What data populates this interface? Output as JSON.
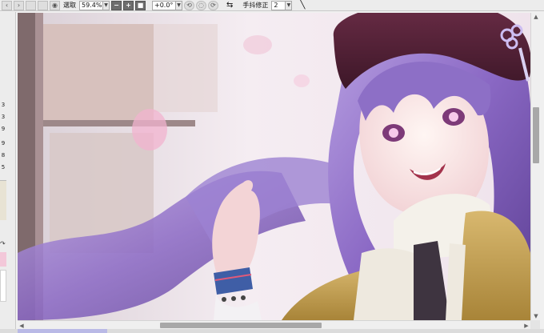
{
  "toolbar": {
    "tool_mode_label": "選取",
    "zoom_value": "59.4%",
    "rotation_value": "+0.0°",
    "stabilizer_label": "手抖修正",
    "stabilizer_value": "2"
  },
  "left_strip": {
    "numbers": [
      "3",
      "3",
      "9",
      "9",
      "8",
      "5"
    ]
  },
  "icons": {
    "eye": "eye-icon",
    "zoom_out": "minus-icon",
    "zoom_in": "plus-icon",
    "fit": "square-icon",
    "rotate_left": "rotate-left-icon",
    "rotate_reset": "rotate-reset-icon",
    "rotate_right": "rotate-right-icon",
    "flip": "flip-arrows-icon",
    "line": "line-tool-icon"
  },
  "colors": {
    "toolbar_bg": "#ececec",
    "scroll_thumb": "#a8a8a8",
    "selection_tab": "#b9b9e6"
  }
}
